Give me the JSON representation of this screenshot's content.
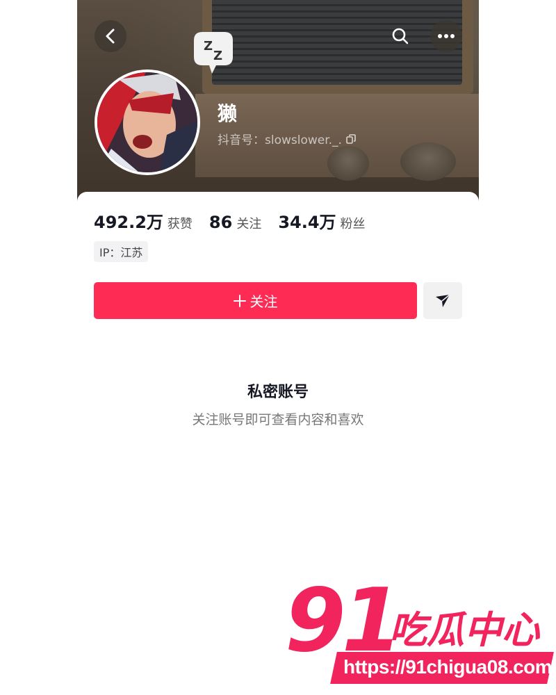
{
  "header": {
    "back_icon": "chevron-left-icon",
    "search_icon": "search-icon",
    "more_icon": "more-horizontal-icon"
  },
  "profile": {
    "username": "獭",
    "douyin_id_label": "抖音号：slowslower._.",
    "stats": [
      {
        "value": "492.2万",
        "label": "获赞"
      },
      {
        "value": "86",
        "label": "关注"
      },
      {
        "value": "34.4万",
        "label": "粉丝"
      }
    ],
    "ip": "IP：江苏"
  },
  "actions": {
    "follow_label": "关注",
    "follow_icon": "plus-icon",
    "share_icon": "send-icon",
    "accent_color": "#fe2c55"
  },
  "private": {
    "title": "私密账号",
    "subtitle": "关注账号即可查看内容和喜欢"
  },
  "watermark": {
    "number": "91",
    "text": "吃瓜中心",
    "url": "https://91chigua08.com",
    "color": "#f1245e"
  }
}
